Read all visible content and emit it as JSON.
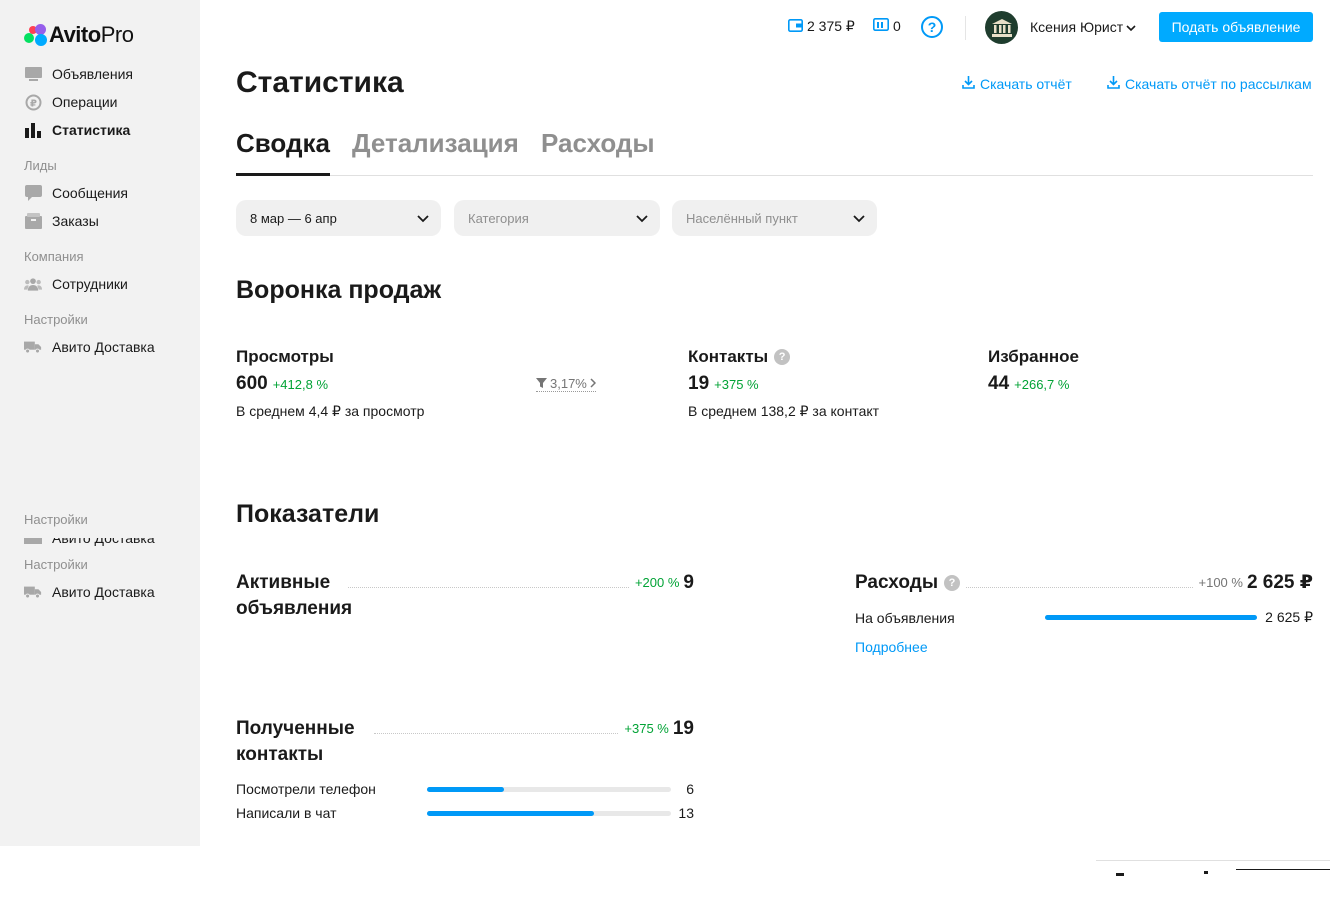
{
  "brand": {
    "name": "Avito",
    "suffix": "Pro"
  },
  "sidebar": {
    "items": [
      {
        "label": "Объявления"
      },
      {
        "label": "Операции"
      },
      {
        "label": "Статистика"
      },
      {
        "label": "Сообщения"
      },
      {
        "label": "Заказы"
      },
      {
        "label": "Сотрудники"
      },
      {
        "label": "Авито Доставка"
      }
    ],
    "sections": [
      "Лиды",
      "Компания",
      "Настройки"
    ],
    "ghost_section_1": "Настройки",
    "ghost_section_2": "Настройки",
    "ghost_item": "Авито Доставка"
  },
  "header": {
    "wallet": "2 375 ₽",
    "bonus": "0",
    "help": "?",
    "user": "Ксения Юрист",
    "post_button": "Подать объявление"
  },
  "page": {
    "title": "Статистика",
    "download_report": "Скачать отчёт",
    "download_mailing_report": "Скачать отчёт по рассылкам",
    "tabs": [
      "Сводка",
      "Детализация",
      "Расходы"
    ]
  },
  "filters": {
    "period": "8 мар — 6 апр",
    "category": "Категория",
    "location": "Населённый пункт"
  },
  "funnel": {
    "title": "Воронка продаж",
    "views": {
      "label": "Просмотры",
      "value": "600",
      "delta": "+412,8 %",
      "sub": "В среднем 4,4 ₽ за просмотр"
    },
    "conversion": "3,17%",
    "contacts": {
      "label": "Контакты",
      "value": "19",
      "delta": "+375 %",
      "sub": "В среднем 138,2 ₽ за контакт"
    },
    "favorites": {
      "label": "Избранное",
      "value": "44",
      "delta": "+266,7 %"
    }
  },
  "indicators": {
    "title": "Показатели",
    "active_ads": {
      "title": "Активные объявления",
      "delta": "+200 %",
      "value": "9"
    },
    "expenses": {
      "title": "Расходы",
      "delta": "+100 %",
      "value": "2 625 ₽",
      "rows": [
        {
          "label": "На объявления",
          "value": "2 625 ₽",
          "fraction": 1.0
        }
      ],
      "more": "Подробнее"
    },
    "contacts": {
      "title": "Полученные контакты",
      "delta": "+375 %",
      "value": "19",
      "rows": [
        {
          "label": "Посмотрели телефон",
          "value": "6",
          "fraction": 0.316
        },
        {
          "label": "Написали в чат",
          "value": "13",
          "fraction": 0.684
        }
      ]
    }
  },
  "colors": {
    "accent": "#00aaff",
    "link": "#0099f7",
    "positive": "#02a336",
    "sidebar_bg": "#f2f2f2"
  }
}
